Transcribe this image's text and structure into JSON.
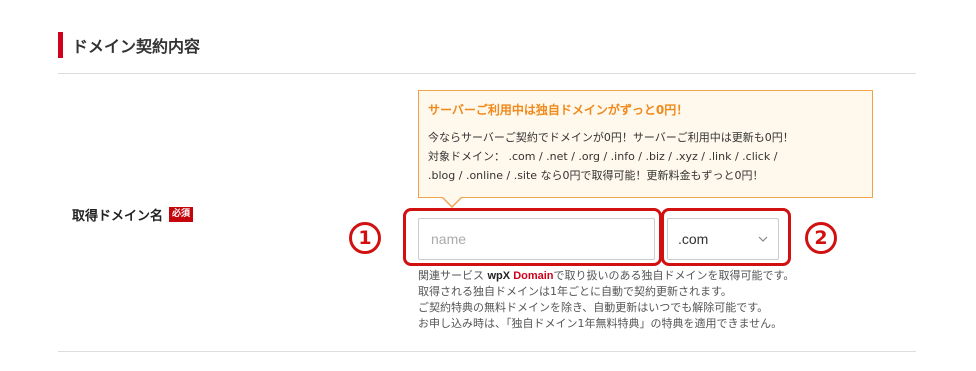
{
  "section": {
    "title": "ドメイン契約内容"
  },
  "field": {
    "label": "取得ドメイン名",
    "required_badge": "必須"
  },
  "tooltip": {
    "title": "サーバーご利用中は独自ドメインがずっと0円！",
    "lines": [
      "今ならサーバーご契約でドメインが0円！サーバーご利用中は更新も0円！",
      "対象ドメイン： .com / .net / .org / .info / .biz / .xyz / .link / .click /",
      ".blog / .online / .site なら0円で取得可能！更新料金もずっと0円！"
    ]
  },
  "markers": {
    "first": "1",
    "second": "2"
  },
  "name_input": {
    "placeholder": "name",
    "value": ""
  },
  "tld_select": {
    "selected": ".com",
    "icon": "chevron-down-icon"
  },
  "help": {
    "line1_prefix": "関連サービス",
    "logo_wpx": "wpX",
    "logo_domain": "Domain",
    "line1_suffix": "で取り扱いのある独自ドメインを取得可能です。",
    "line2": "取得される独自ドメインは1年ごとに自動で契約更新されます。",
    "line3": "ご契約特典の無料ドメインを除き、自動更新はいつでも解除可能です。",
    "line4": "お申し込み時は、「独自ドメイン1年無料特典」の特典を適用できません。"
  },
  "colors": {
    "accent_red": "#d0021b",
    "tooltip_border": "#f0a24c",
    "tooltip_title": "#f08a1c",
    "tooltip_bg": "#fff8ec",
    "annotation_red": "#d11010"
  }
}
